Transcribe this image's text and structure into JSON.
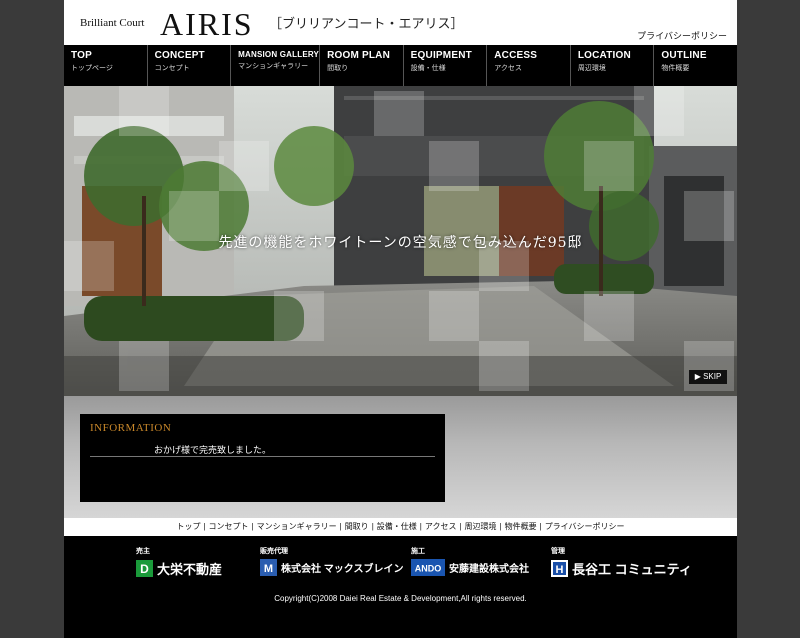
{
  "header": {
    "brand_small": "Brilliant Court",
    "brand_big": "AIRIS",
    "brand_kana": "［ブリリアンコート・エアリス］",
    "privacy_link": "プライバシーポリシー"
  },
  "nav": [
    {
      "en": "TOP",
      "ja": "トップページ"
    },
    {
      "en": "CONCEPT",
      "ja": "コンセプト"
    },
    {
      "en": "MANSION GALLERY",
      "ja": "マンションギャラリー"
    },
    {
      "en": "ROOM PLAN",
      "ja": "間取り"
    },
    {
      "en": "EQUIPMENT",
      "ja": "設備・仕様"
    },
    {
      "en": "ACCESS",
      "ja": "アクセス"
    },
    {
      "en": "LOCATION",
      "ja": "周辺環境"
    },
    {
      "en": "OUTLINE",
      "ja": "物件概要"
    }
  ],
  "hero": {
    "caption": "先進の機能をホワイトーンの空気感で包み込んだ95邸",
    "skip_label": "▶ SKIP"
  },
  "information": {
    "title": "INFORMATION",
    "message": "おかげ様で完売致しました。"
  },
  "footer_nav": [
    "トップ",
    "コンセプト",
    "マンションギャラリー",
    "間取り",
    "設備・仕様",
    "アクセス",
    "周辺環境",
    "物件概要",
    "プライバシーポリシー"
  ],
  "companies": [
    {
      "role": "売主",
      "name": "大栄不動産",
      "mark": "D"
    },
    {
      "role": "販売代理",
      "name": "株式会社 マックスブレイン",
      "mark": "M"
    },
    {
      "role": "施工",
      "name": "安藤建設株式会社",
      "mark": "ANDO"
    },
    {
      "role": "管理",
      "name": "長谷工 コミュニティ",
      "mark": "H"
    }
  ],
  "copyright": "Copyright(C)2008 Daiei Real Estate & Development,All rights reserved.",
  "colors": {
    "page_bg": "#3a3a3a",
    "nav_bg": "#000000",
    "info_title": "#c8872a"
  }
}
